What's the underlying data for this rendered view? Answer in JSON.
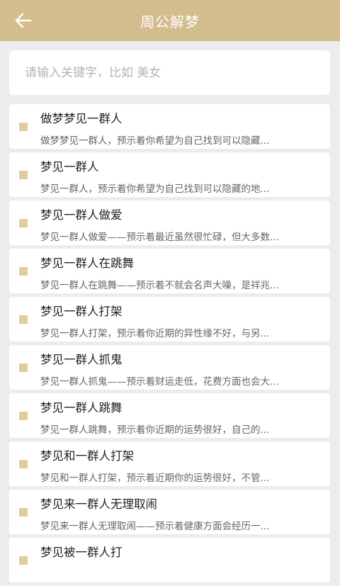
{
  "header": {
    "title": "周公解梦",
    "back_icon": "back-arrow-icon",
    "background": "#d3bc8d"
  },
  "search": {
    "placeholder": "请输入关键字，比如 美女",
    "value": ""
  },
  "results": [
    {
      "title": "做梦梦见一群人",
      "desc": "做梦梦见一群人，预示着你希望为自己找到可以隐藏..."
    },
    {
      "title": "梦见一群人",
      "desc": "梦见一群人，预示着你希望为自己找到可以隐藏的地..."
    },
    {
      "title": "梦见一群人做爱",
      "desc": "梦见一群人做爱——预示着最近虽然很忙碌，但大多数..."
    },
    {
      "title": "梦见一群人在跳舞",
      "desc": "梦见一群人在跳舞——预示着不就会名声大噪，是祥兆..."
    },
    {
      "title": "梦见一群人打架",
      "desc": "梦见一群人打架，预示着你近期的异性缘不好，与另..."
    },
    {
      "title": "梦见一群人抓鬼",
      "desc": "梦见一群人抓鬼——预示着财运走低，花费方面也会大..."
    },
    {
      "title": "梦见一群人跳舞",
      "desc": "梦见一群人跳舞，预示着你近期的运势很好，自己的..."
    },
    {
      "title": "梦见和一群人打架",
      "desc": "梦见和一群人打架，预示着近期你的运势很好，不管..."
    },
    {
      "title": "梦见来一群人无理取闹",
      "desc": "梦见来一群人无理取闹——预示着健康方面会经历一..."
    },
    {
      "title": "梦见被一群人打",
      "desc": ""
    }
  ]
}
